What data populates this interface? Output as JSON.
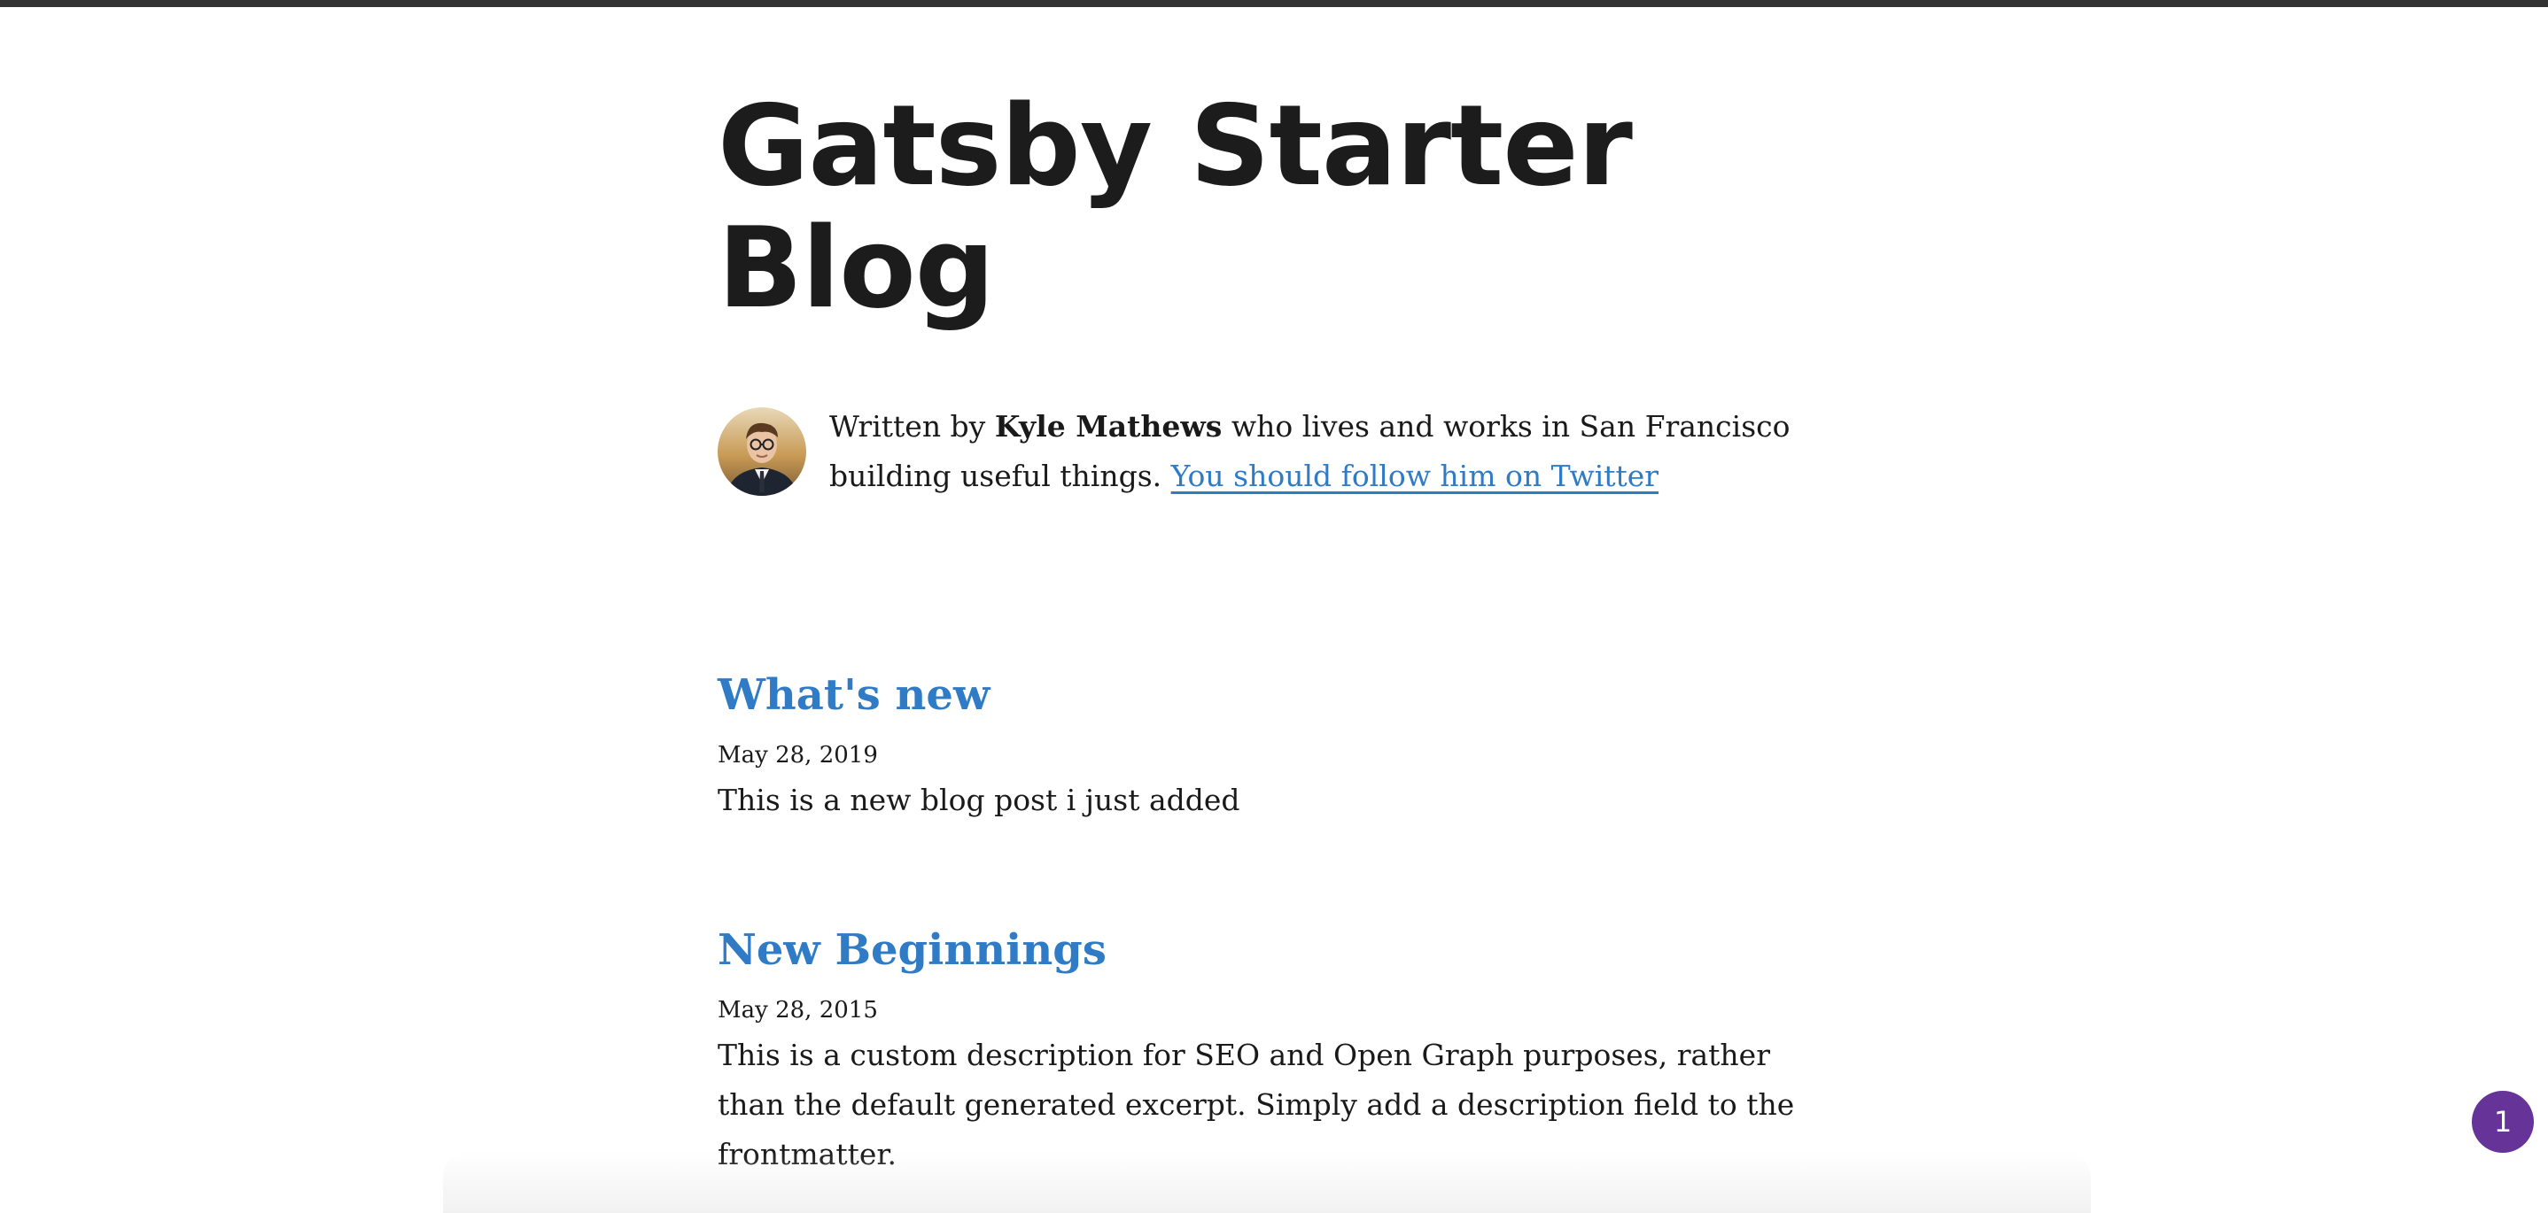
{
  "site": {
    "title": "Gatsby Starter Blog"
  },
  "bio": {
    "prefix": "Written by ",
    "author": "Kyle Mathews",
    "suffix": " who lives and works in San Francisco building useful things. ",
    "link_text": "You should follow him on Twitter",
    "avatar_icon": "author-avatar"
  },
  "posts": [
    {
      "title": "What's new",
      "date": "May 28, 2019",
      "description": "This is a new blog post i just added"
    },
    {
      "title": "New Beginnings",
      "date": "May 28, 2015",
      "description": "This is a custom description for SEO and Open Graph purposes, rather than the default generated excerpt. Simply add a description field to the frontmatter."
    }
  ],
  "badge": {
    "count": "1",
    "color": "#663399"
  },
  "colors": {
    "link": "#2f7bc5",
    "text": "#1a1a1a",
    "top_bar": "#333333"
  }
}
